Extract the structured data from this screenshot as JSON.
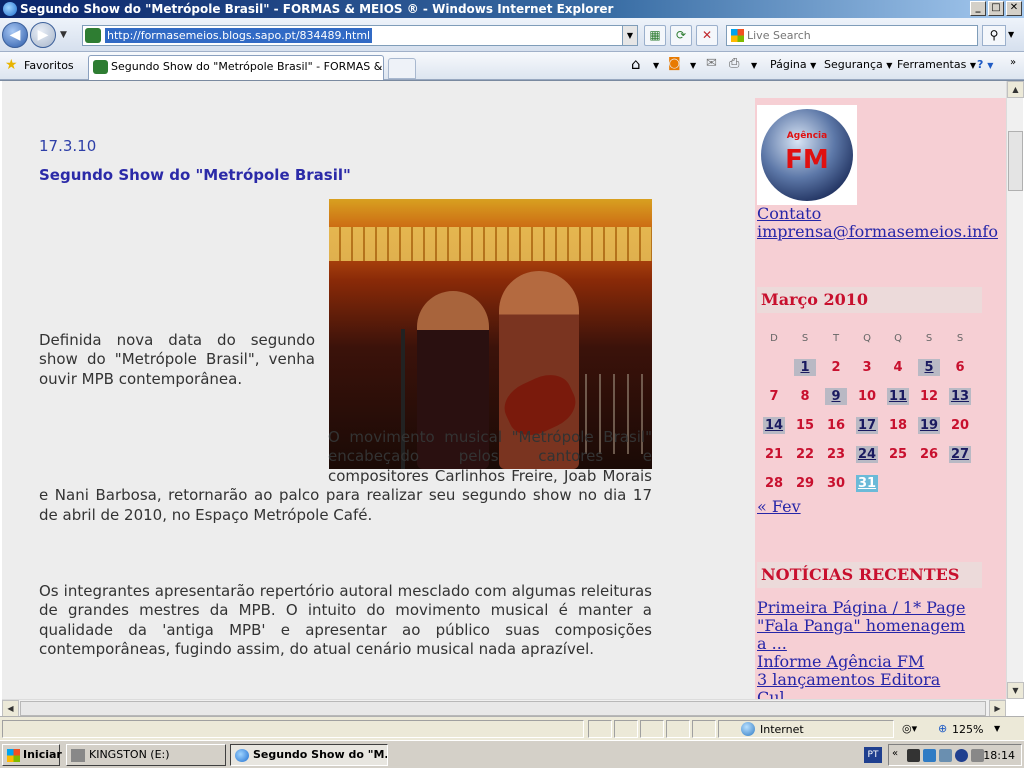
{
  "window": {
    "title": "Segundo Show do \"Metrópole Brasil\" - FORMAS & MEIOS ® - Windows Internet Explorer",
    "min": "_",
    "max": "□",
    "close": "✕"
  },
  "address": {
    "url": "http://formasemeios.blogs.sapo.pt/834489.html",
    "search_placeholder": "Live Search"
  },
  "favbar": {
    "favorites": "Favoritos",
    "tab_title": "Segundo Show do \"Metrópole Brasil\" - FORMAS & MEI...",
    "cmd_page": "Página",
    "cmd_security": "Segurança",
    "cmd_tools": "Ferramentas"
  },
  "post": {
    "date": "17.3.10",
    "title": "Segundo Show do \"Metrópole Brasil\"",
    "p1": "Definida nova data do segundo show do \"Metrópole Brasil\", venha ouvir MPB contemporânea.",
    "p2": "O movimento musical \"Metrópole Brasil\" encabeçado pelos cantores e compositores Carlinhos Freire, Joab Morais e Nani Barbosa, retornarão ao palco para realizar seu segundo show no dia 17 de abril de 2010, no Espaço Metrópole Café.",
    "p3": "Os integrantes apresentarão repertório autoral mesclado com algumas releituras de grandes mestres da MPB. O intuito do movimento musical é manter a qualidade da 'antiga MPB' e apresentar ao público suas composições contemporâneas, fugindo assim, do atual cenário musical nada aprazível."
  },
  "sidebar": {
    "logo_agency": "Agência",
    "logo_text": "FM",
    "contact": "Contato",
    "email": "imprensa@formasemeios.info",
    "calendar_title": "Março 2010",
    "weekdays": [
      "D",
      "S",
      "T",
      "Q",
      "Q",
      "S",
      "S"
    ],
    "weeks": [
      [
        "",
        "1",
        "2",
        "3",
        "4",
        "5",
        "6"
      ],
      [
        "7",
        "8",
        "9",
        "10",
        "11",
        "12",
        "13"
      ],
      [
        "14",
        "15",
        "16",
        "17",
        "18",
        "19",
        "20"
      ],
      [
        "21",
        "22",
        "23",
        "24",
        "25",
        "26",
        "27"
      ],
      [
        "28",
        "29",
        "30",
        "31",
        "",
        "",
        ""
      ]
    ],
    "linked_days": [
      "1",
      "5",
      "9",
      "11",
      "13",
      "14",
      "17",
      "19",
      "24",
      "27"
    ],
    "today": "31",
    "prev_month": "« Fev",
    "recent_title": "NOTÍCIAS RECENTES",
    "recent": [
      "Primeira Página / 1* Page",
      "\"Fala Panga\" homenagem",
      "a ...",
      "Informe Agência FM",
      "3 lançamentos Editora",
      "Cul..."
    ]
  },
  "status": {
    "zone": "Internet",
    "zoom": "125%"
  },
  "taskbar": {
    "start": "Iniciar",
    "task1": "KINGSTON (E:)",
    "task2": "Segundo Show do \"M...",
    "lang": "PT",
    "clock": "18:14"
  },
  "colors": {
    "link": "#2626a8",
    "sidebar_bg": "#f6cfd4",
    "calendar_red": "#c8102e",
    "post_title": "#2b2aa8"
  }
}
